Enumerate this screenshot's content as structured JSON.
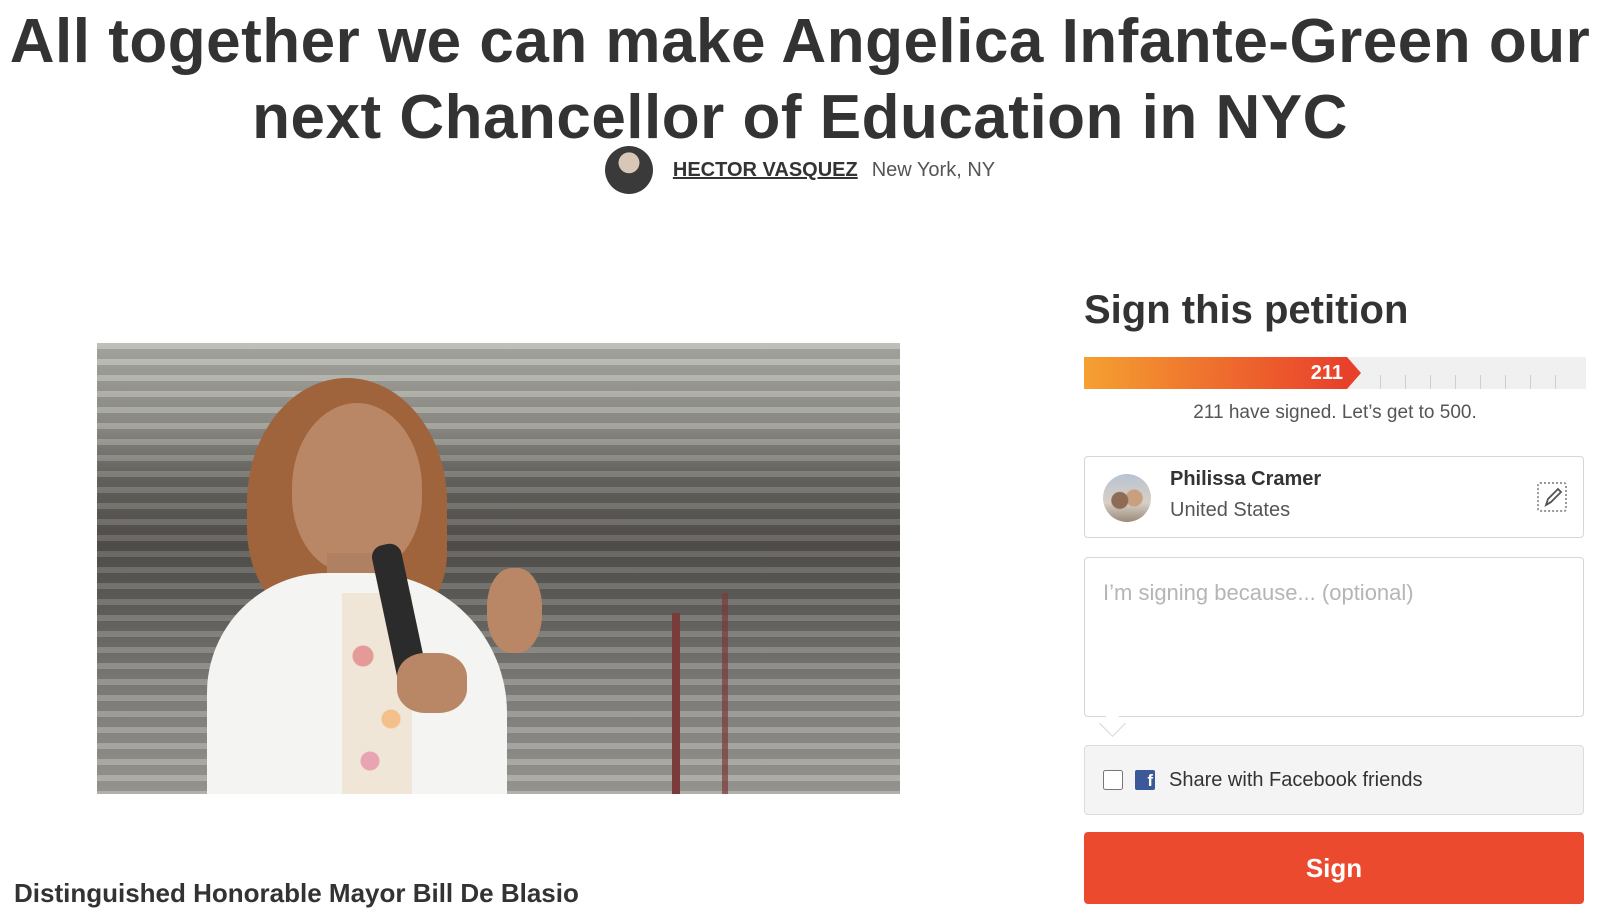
{
  "petition": {
    "title": "All together we can make Angelica Infante-Green our next Chancellor of Education in NYC",
    "author_name": "HECTOR VASQUEZ",
    "author_location": "New York, NY",
    "letter_heading": "Distinguished Honorable Mayor Bill De Blasio"
  },
  "sign_panel": {
    "heading": "Sign this petition",
    "signature_count": "211",
    "progress_text": "211 have signed. Let’s get to 500.",
    "progress_fraction": 0.422,
    "signer_name": "Philissa Cramer",
    "signer_country": "United States",
    "reason_placeholder": "I’m signing because... (optional)",
    "share_label": "Share with Facebook friends",
    "sign_button_label": "Sign"
  },
  "icons": {
    "edit": "edit-pencil-icon",
    "facebook": "facebook-icon"
  },
  "colors": {
    "accent": "#ec4a2f",
    "progress_start": "#f5a031",
    "progress_end": "#e8402b",
    "facebook": "#3b5998"
  }
}
